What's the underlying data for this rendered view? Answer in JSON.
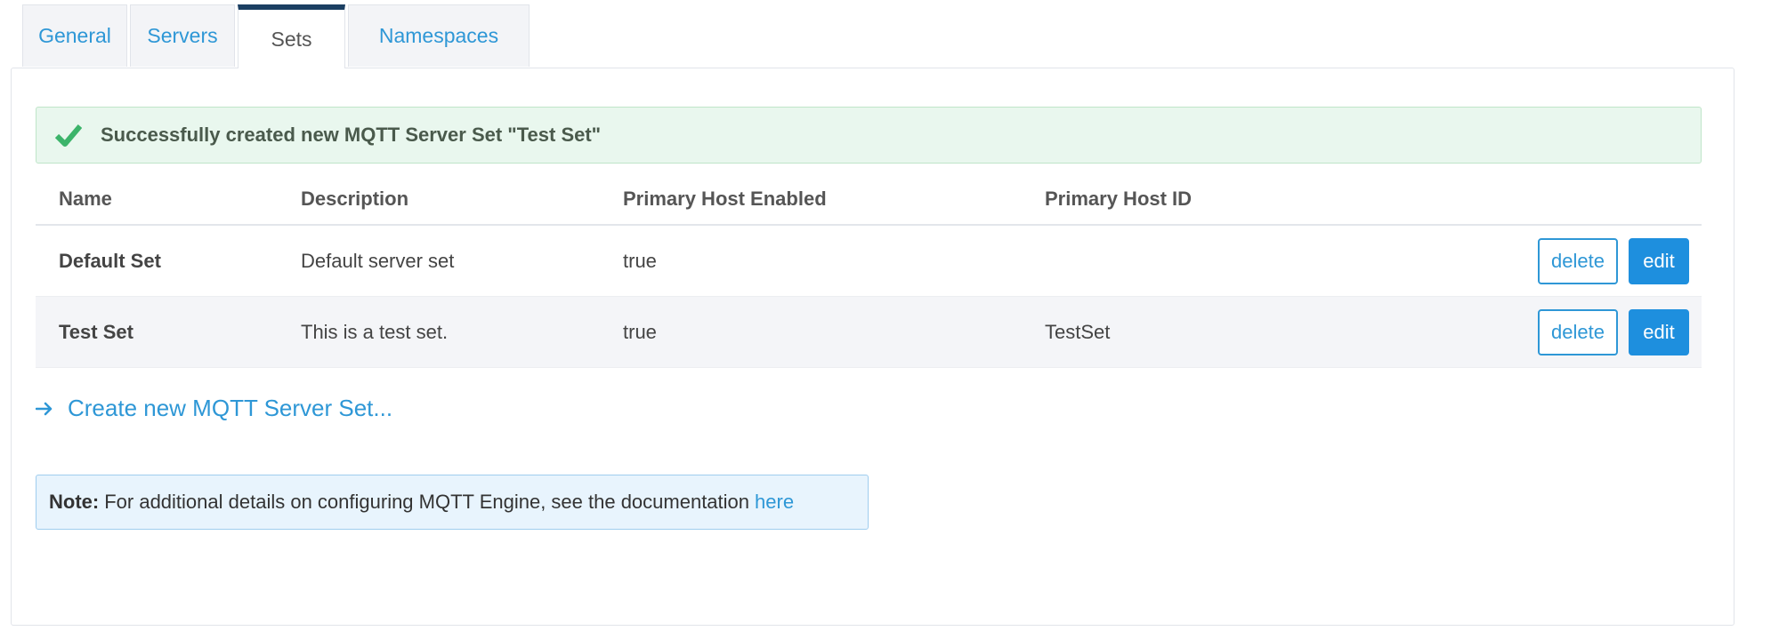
{
  "tabs": [
    {
      "label": "General"
    },
    {
      "label": "Servers"
    },
    {
      "label": "Sets",
      "active": true
    },
    {
      "label": "Namespaces"
    }
  ],
  "alert": {
    "message": "Successfully created new MQTT Server Set \"Test Set\"",
    "icon": "check-icon",
    "color": "#3cb46a"
  },
  "table": {
    "headers": [
      "Name",
      "Description",
      "Primary Host Enabled",
      "Primary Host ID"
    ],
    "rows": [
      {
        "name": "Default Set",
        "description": "Default server set",
        "enabled": "true",
        "host_id": "",
        "delete_label": "delete",
        "edit_label": "edit"
      },
      {
        "name": "Test Set",
        "description": "This is a test set.",
        "enabled": "true",
        "host_id": "TestSet",
        "delete_label": "delete",
        "edit_label": "edit"
      }
    ]
  },
  "create_link": {
    "label": "Create new MQTT Server Set...",
    "icon": "arrow-right-icon"
  },
  "note": {
    "label": "Note:",
    "text": "For additional details on configuring MQTT Engine, see the documentation",
    "link": "here"
  },
  "colors": {
    "accent": "#2e97d6",
    "active_tab_border": "#1b3f62",
    "success_bg": "#e9f7ee",
    "info_bg": "#e8f4fd"
  }
}
